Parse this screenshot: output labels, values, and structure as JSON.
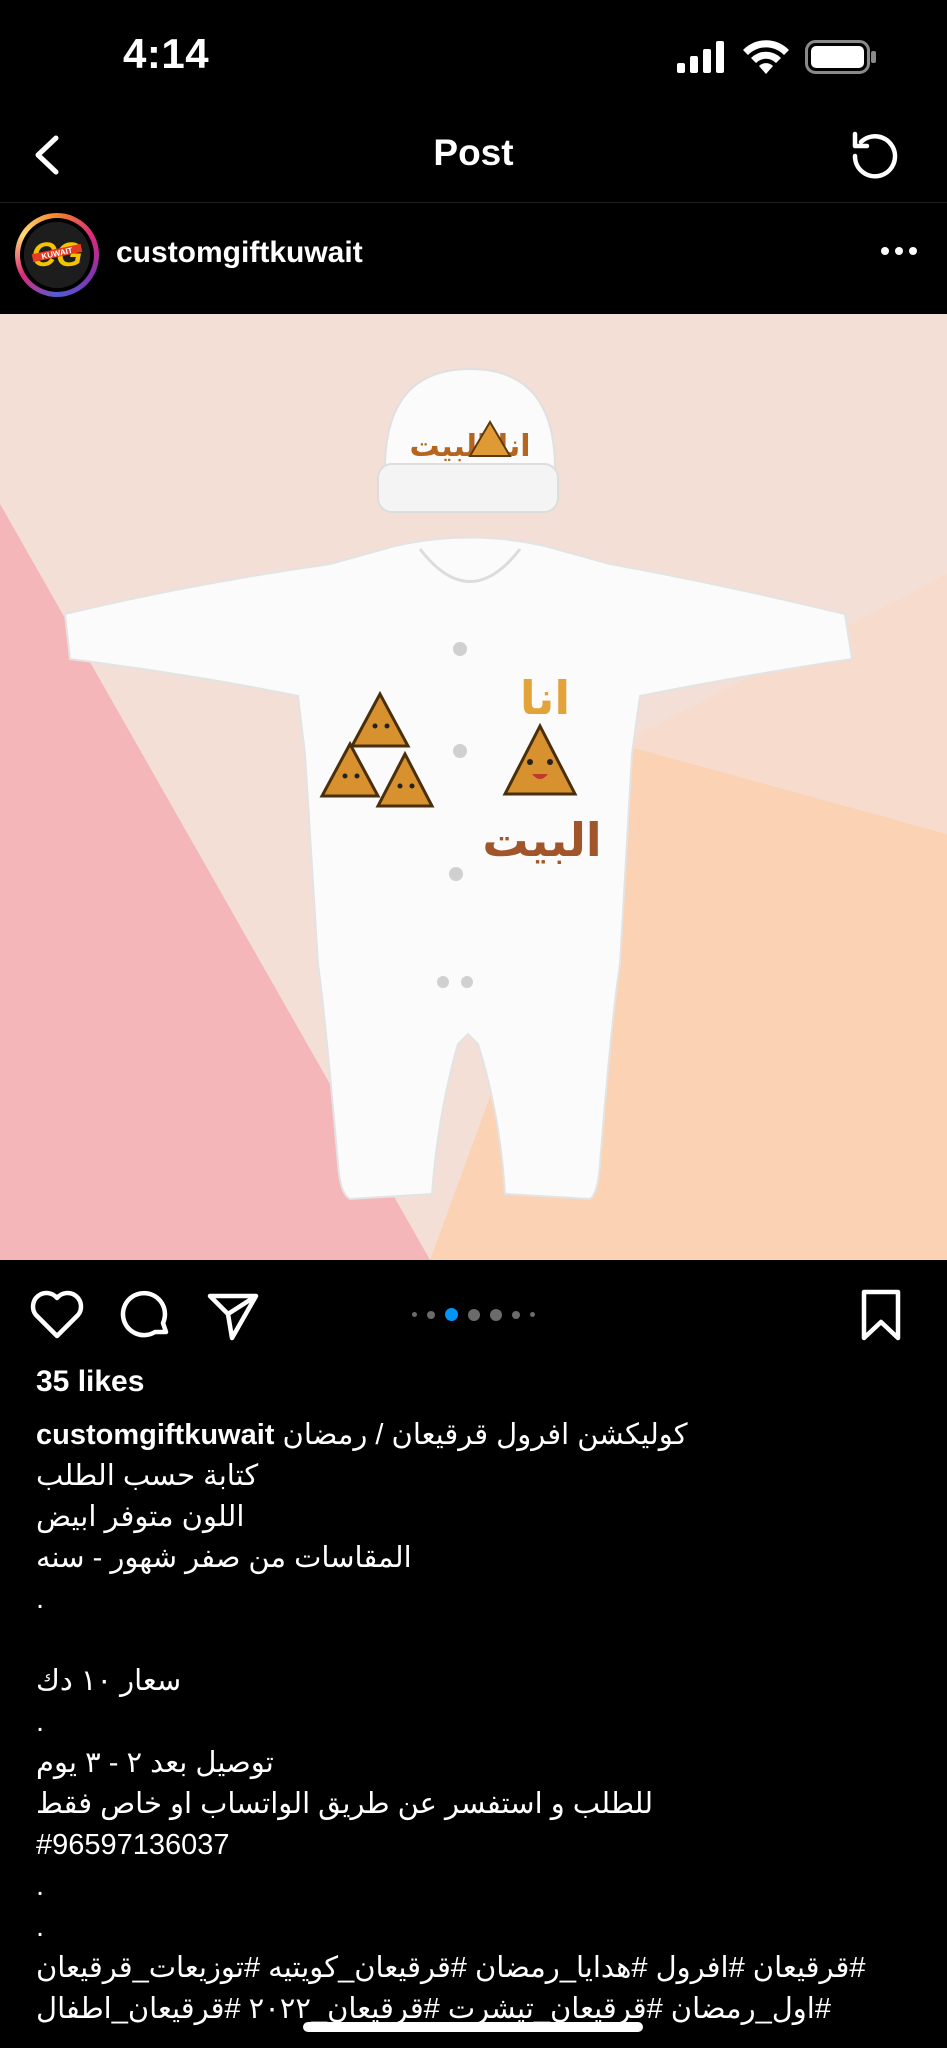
{
  "status_bar": {
    "time": "4:14"
  },
  "nav": {
    "title": "Post"
  },
  "post": {
    "username": "customgiftkuwait",
    "avatar_text": "KUWAIT",
    "image": {
      "hat_text": "انا البيت",
      "onesie_text_top": "انا",
      "onesie_text_bottom": "البيت"
    },
    "carousel": {
      "count": 7,
      "active_index": 2
    },
    "likes": "35 likes",
    "caption": {
      "first_line": "كوليكشن افرول قرقيعان / رمضان",
      "lines": [
        "كتابة حسب الطلب",
        "اللون متوفر ابيض",
        "المقاسات من صفر شهور - سنه",
        ".",
        "",
        "سعار ١٠ دك",
        ".",
        "توصيل بعد ٢ - ٣ يوم",
        "للطلب و استفسر عن طريق الواتساب او خاص فقط",
        "#96597136037",
        ".",
        ".",
        "#قرقيعان #افرول #هدايا_رمضان #قرقيعان_كويتيه #توزيعات_قرقيعان",
        "#اول_رمضان #قرقيعان_تيشرت #قرقيعان_٢٠٢٢ #قرقيعان_اطفال"
      ]
    }
  },
  "colors": {
    "background": "#000000",
    "accent_blue": "#0095f6",
    "text": "#ffffff"
  }
}
